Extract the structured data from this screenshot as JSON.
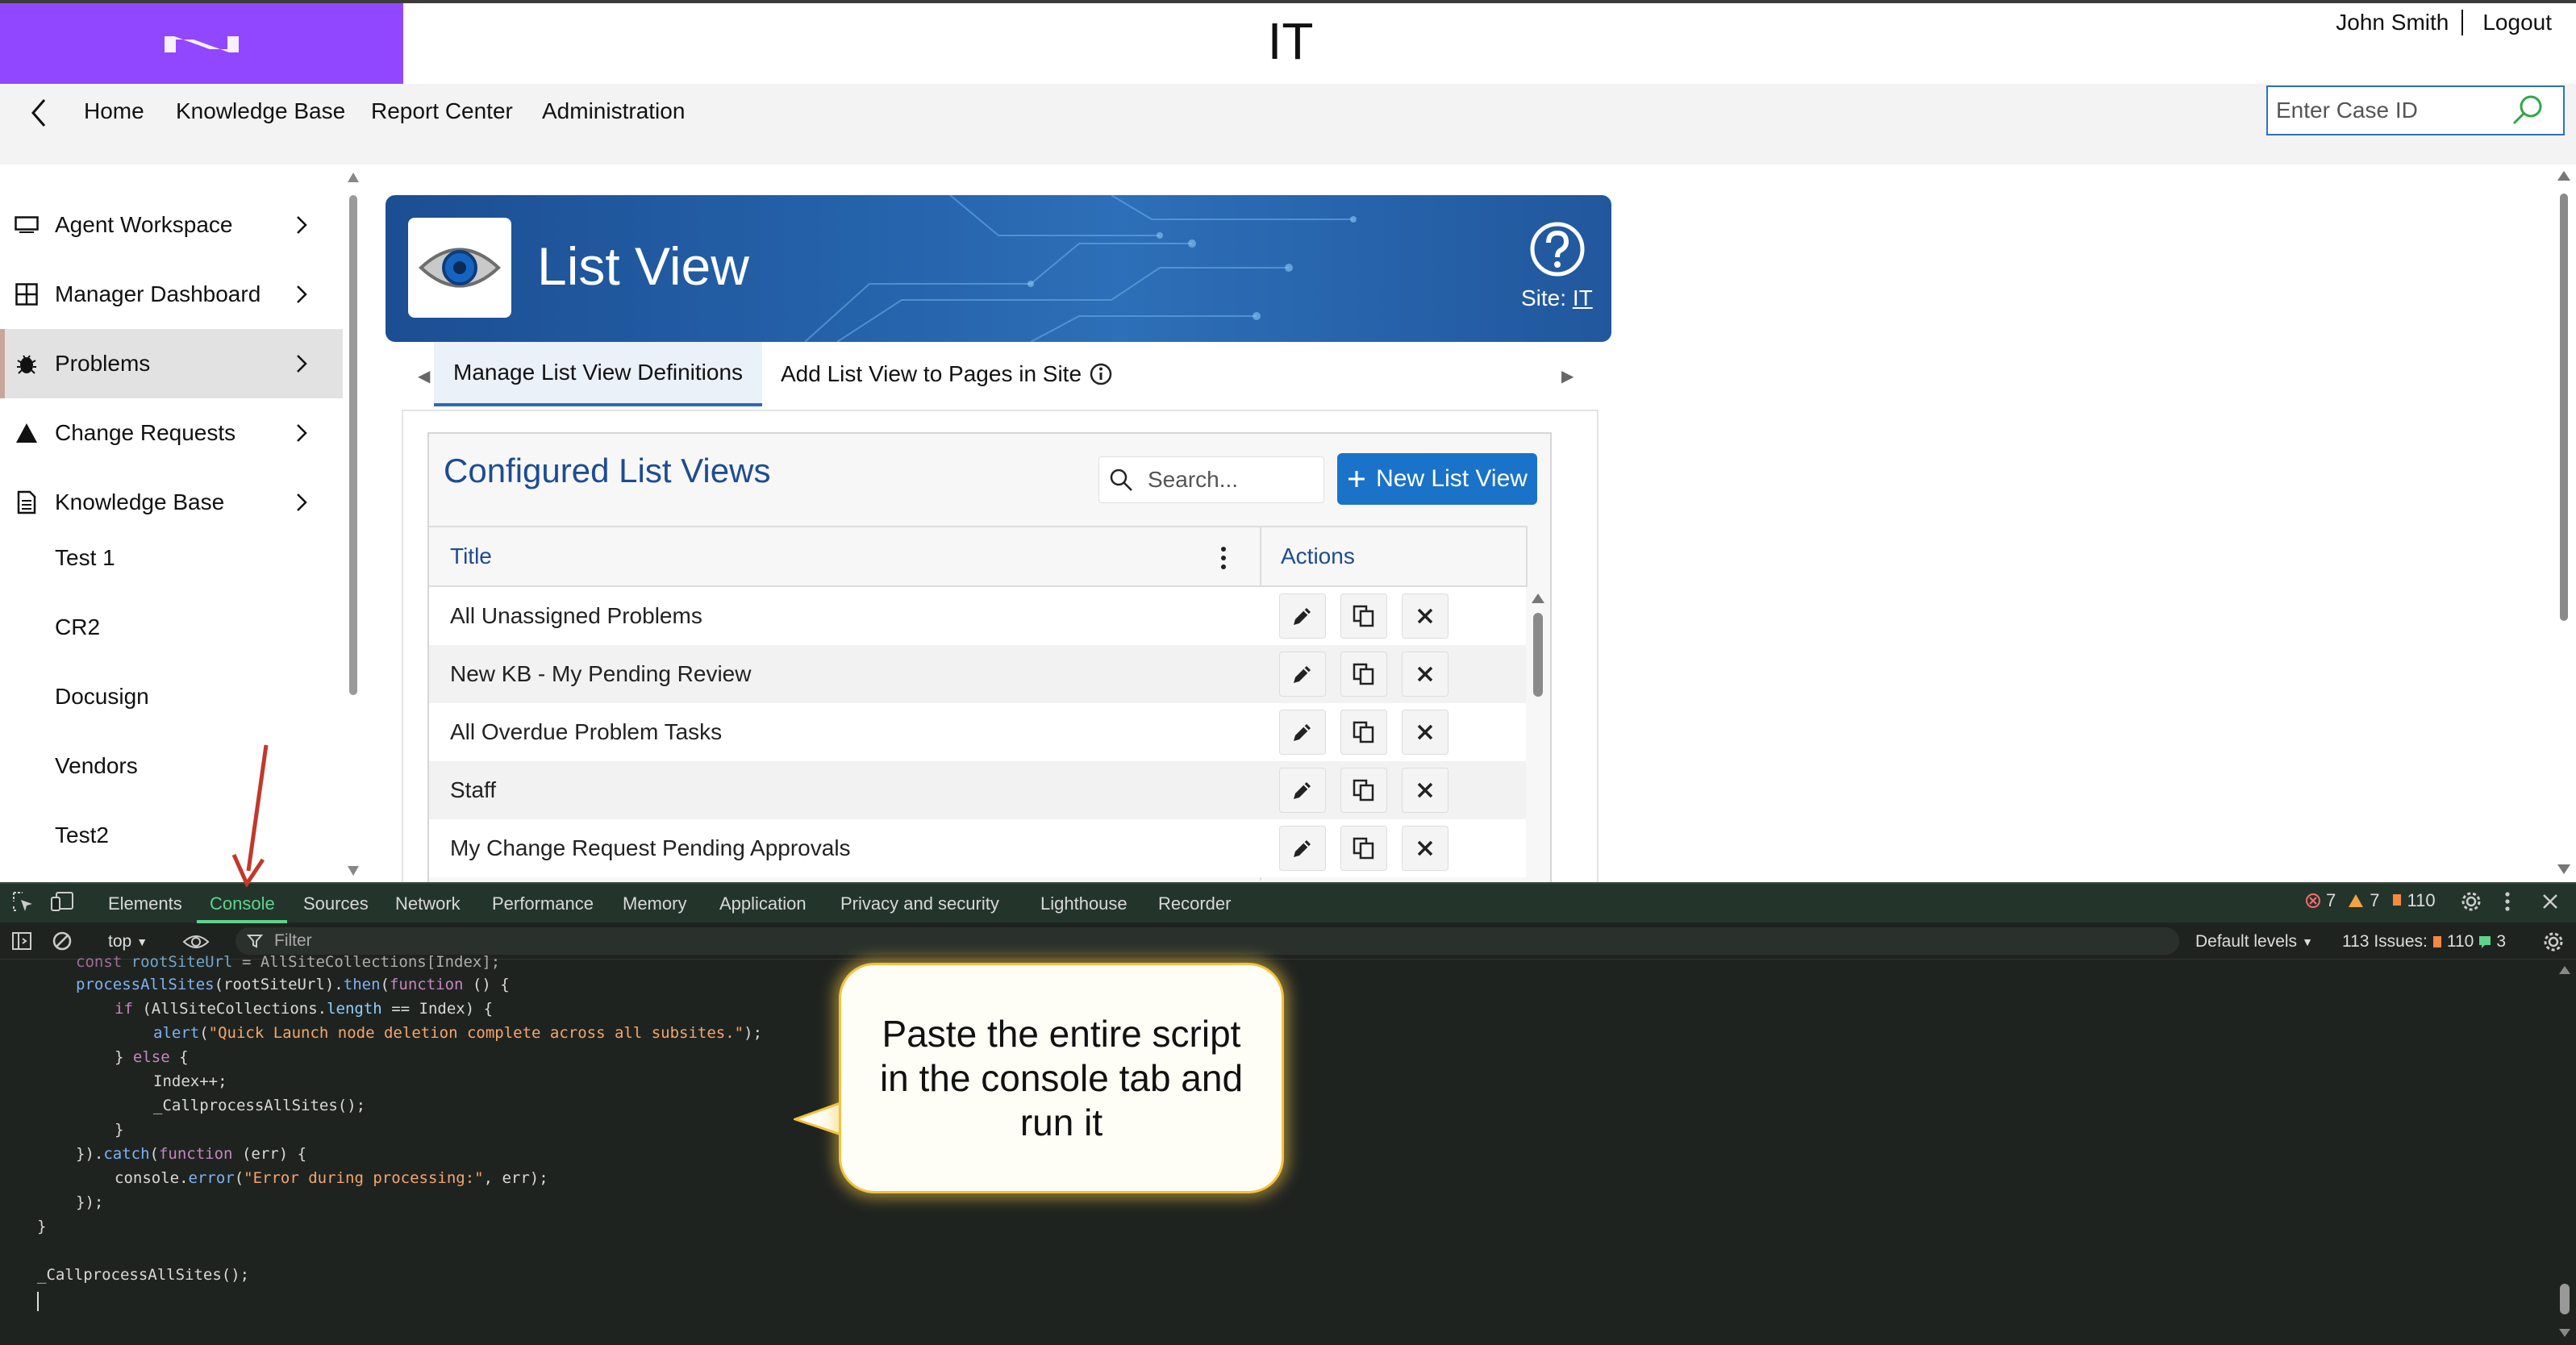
{
  "header": {
    "app_title": "IT",
    "user_name": "John Smith",
    "logout_label": "Logout",
    "case_placeholder": "Enter Case ID"
  },
  "nav": {
    "links": [
      "Home",
      "Knowledge Base",
      "Report Center",
      "Administration"
    ]
  },
  "sidebar": {
    "items": [
      {
        "label": "Agent Workspace",
        "icon": "monitor-icon"
      },
      {
        "label": "Manager Dashboard",
        "icon": "grid-icon"
      },
      {
        "label": "Problems",
        "icon": "bug-icon",
        "active": true
      },
      {
        "label": "Change Requests",
        "icon": "triangle-icon"
      },
      {
        "label": "Knowledge Base",
        "icon": "document-icon"
      }
    ],
    "sub_items": [
      "Test 1",
      "CR2",
      "Docusign",
      "Vendors",
      "Test2"
    ]
  },
  "banner": {
    "title": "List View",
    "site_prefix": "Site:",
    "site_link": "IT"
  },
  "tabs": [
    {
      "label": "Manage List View Definitions",
      "active": true
    },
    {
      "label": "Add List View to Pages in Site"
    }
  ],
  "list_panel": {
    "title": "Configured List Views",
    "search_placeholder": "Search...",
    "new_button": "New List View",
    "columns": [
      "Title",
      "Actions"
    ],
    "rows": [
      "All Unassigned Problems",
      "New KB - My Pending Review",
      "All Overdue Problem Tasks",
      "Staff",
      "My Change Request Pending Approvals"
    ]
  },
  "devtools": {
    "tabs": [
      "Elements",
      "Console",
      "Sources",
      "Network",
      "Performance",
      "Memory",
      "Application",
      "Privacy and security",
      "Lighthouse",
      "Recorder"
    ],
    "active_tab": "Console",
    "errors": "7",
    "warnings": "7",
    "infos": "110",
    "context": "top",
    "filter_placeholder": "Filter",
    "levels": "Default levels",
    "issues_label": "113 Issues:",
    "issues_info": "110",
    "issues_msgs": "3"
  },
  "callout": {
    "text": "Paste the entire script in the console tab and run it"
  },
  "colors": {
    "brand_purple": "#9147ff",
    "primary_blue": "#1a73c8",
    "title_blue": "#1e4c91",
    "devtools_green": "#5fd38e"
  }
}
